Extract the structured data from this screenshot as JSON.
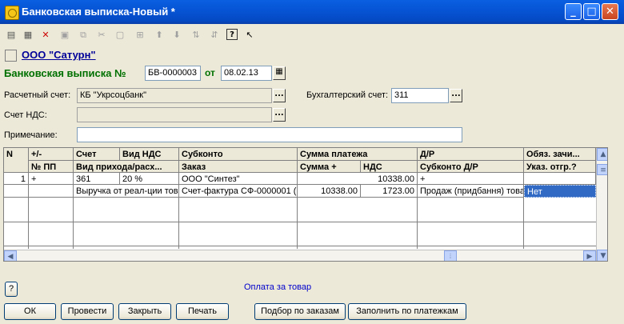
{
  "window": {
    "title": "Банковская выписка-Новый *",
    "minimize": "_",
    "maximize": "□",
    "close": "✕"
  },
  "org": {
    "name": "ООО \"Сатурн\""
  },
  "header": {
    "title": "Банковская выписка №",
    "number": "БВ-0000003",
    "date_label": "от",
    "date": "08.02.13"
  },
  "fields": {
    "account_label": "Расчетный счет:",
    "account_value": "КБ \"Укрсоцбанк\"",
    "acc_label": "Бухгалтерский счет:",
    "acc_value": "311",
    "vat_label": "Счет НДС:",
    "vat_value": "",
    "note_label": "Примечание:",
    "note_value": ""
  },
  "table": {
    "headers_row1": [
      "N",
      "+/-",
      "Счет",
      "Вид НДС",
      "Субконто",
      "Сумма платежа",
      "Д/Р",
      "Обяз. зачи..."
    ],
    "headers_row2": [
      "№ ПП",
      "Вид прихода/расх...",
      "Заказ",
      "Сумма +",
      "НДС",
      "Субконто Д/Р",
      "Указ. отгр.?"
    ],
    "row1": {
      "n": "1",
      "sign": "+",
      "account": "361",
      "vat_type": "20 %",
      "subconto": "ООО \"Синтез\"",
      "payment_sum": "10338.00",
      "dr": "+"
    },
    "row2": {
      "income_type": "Выручка от реал-ции тов",
      "order": "Счет-фактура СФ-0000001 (",
      "sum_plus": "10338.00",
      "vat": "1723.00",
      "subconto_dr": "Продаж (придбання) това",
      "shipment": "Нет"
    }
  },
  "footer": {
    "help": "?",
    "status": "Оплата за товар"
  },
  "buttons": {
    "ok": "ОК",
    "post": "Провести",
    "close": "Закрыть",
    "print": "Печать",
    "by_orders": "Подбор по заказам",
    "fill": "Заполнить по платежкам"
  },
  "colors": {
    "title_bar": "#0655d6",
    "form_title": "#007000",
    "org_link": "#000099",
    "status_text": "#0000cc",
    "selection": "#316ac5"
  }
}
